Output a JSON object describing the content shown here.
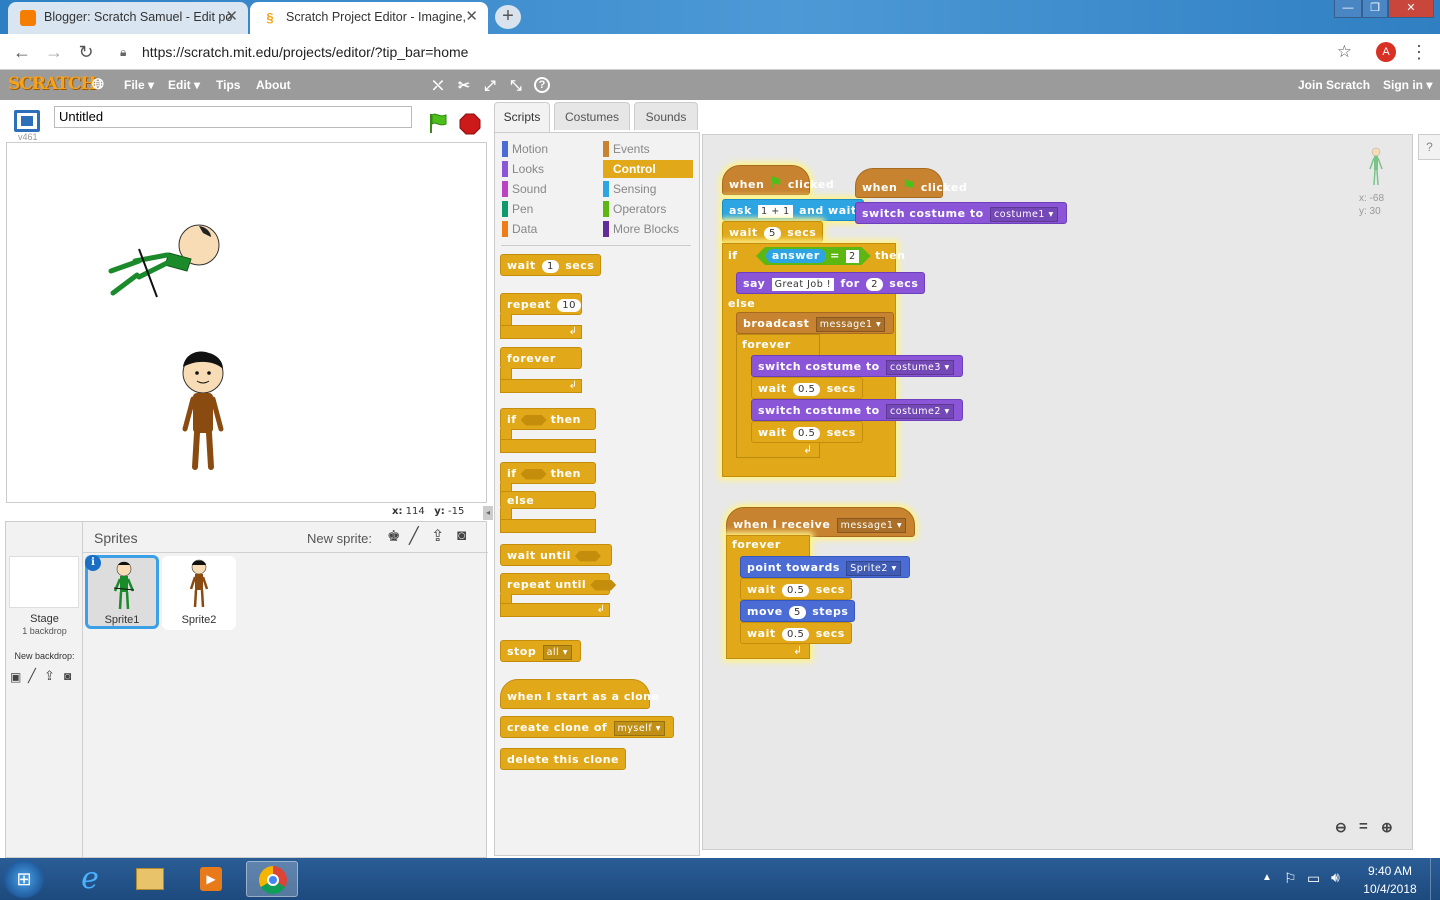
{
  "browser": {
    "tabs": [
      {
        "title": "Blogger: Scratch Samuel - Edit po",
        "active": false
      },
      {
        "title": "Scratch Project Editor - Imagine,",
        "active": true
      }
    ],
    "new_tab": "+",
    "window_buttons": [
      "—",
      "❐",
      "✕"
    ],
    "url": "https://scratch.mit.edu/projects/editor/?tip_bar=home",
    "profile_initial": "A",
    "colors": {
      "tab_bar": "#2d7fc4",
      "profile": "#d93025"
    }
  },
  "scratch_menu": {
    "logo": "SCRATCH",
    "items": [
      "File ▾",
      "Edit ▾",
      "Tips",
      "About"
    ],
    "join": "Join Scratch",
    "sign_in": "Sign in ▾",
    "tool_icons": [
      "duplicate-icon",
      "cut-icon",
      "grow-icon",
      "shrink-icon",
      "help-icon"
    ]
  },
  "stage": {
    "project_title": "Untitled",
    "version": "v461",
    "coords": {
      "x_label": "x:",
      "x": "114",
      "y_label": "y:",
      "y": "-15"
    }
  },
  "sprites_panel": {
    "title": "Sprites",
    "new_sprite_label": "New sprite:",
    "stage_label": "Stage",
    "stage_sub": "1 backdrop",
    "new_backdrop_label": "New backdrop:",
    "sprites": [
      {
        "name": "Sprite1",
        "selected": true
      },
      {
        "name": "Sprite2",
        "selected": false
      }
    ]
  },
  "editor_tabs": [
    "Scripts",
    "Costumes",
    "Sounds"
  ],
  "categories": [
    {
      "name": "Motion",
      "color": "#4a6cd4"
    },
    {
      "name": "Events",
      "color": "#c88330"
    },
    {
      "name": "Looks",
      "color": "#8a55d7"
    },
    {
      "name": "Control",
      "color": "#e1a91a"
    },
    {
      "name": "Sound",
      "color": "#bb42c3"
    },
    {
      "name": "Sensing",
      "color": "#2ca5e2"
    },
    {
      "name": "Pen",
      "color": "#0e9a6c"
    },
    {
      "name": "Operators",
      "color": "#5cb712"
    },
    {
      "name": "Data",
      "color": "#ee7d16"
    },
    {
      "name": "More Blocks",
      "color": "#632d99"
    }
  ],
  "palette": {
    "wait": "wait",
    "wait_num": "1",
    "secs": "secs",
    "repeat": "repeat",
    "repeat_num": "10",
    "forever": "forever",
    "if": "if",
    "then": "then",
    "else": "else",
    "wait_until": "wait until",
    "repeat_until": "repeat until",
    "stop": "stop",
    "stop_opt": "all",
    "clone_hat": "when I start as a clone",
    "create_clone": "create clone of",
    "clone_opt": "myself",
    "delete_clone": "delete this clone"
  },
  "scripts": {
    "when": "when",
    "clicked": "clicked",
    "ask": "ask",
    "ask_val": "1 + 1",
    "and_wait": "and wait",
    "wait": "wait",
    "five": "5",
    "secs": "secs",
    "if": "if",
    "answer": "answer",
    "eq": "=",
    "two": "2",
    "then": "then",
    "say": "say",
    "say_val": "Great Job !",
    "for": "for",
    "else": "else",
    "broadcast": "broadcast",
    "message1": "message1",
    "forever": "forever",
    "switch_costume": "switch costume to",
    "costume1": "costume1",
    "costume3": "costume3",
    "costume2": "costume2",
    "half": "0.5",
    "when_receive": "when I receive",
    "point_towards": "point towards",
    "sprite2": "Sprite2",
    "move": "move",
    "steps": "steps"
  },
  "sprite_info": {
    "x": "x: -68",
    "y": "y: 30"
  },
  "zoom_icons": [
    "zoom-out-icon",
    "zoom-reset-icon",
    "zoom-in-icon"
  ],
  "taskbar": {
    "time": "9:40 AM",
    "date": "10/4/2018"
  }
}
